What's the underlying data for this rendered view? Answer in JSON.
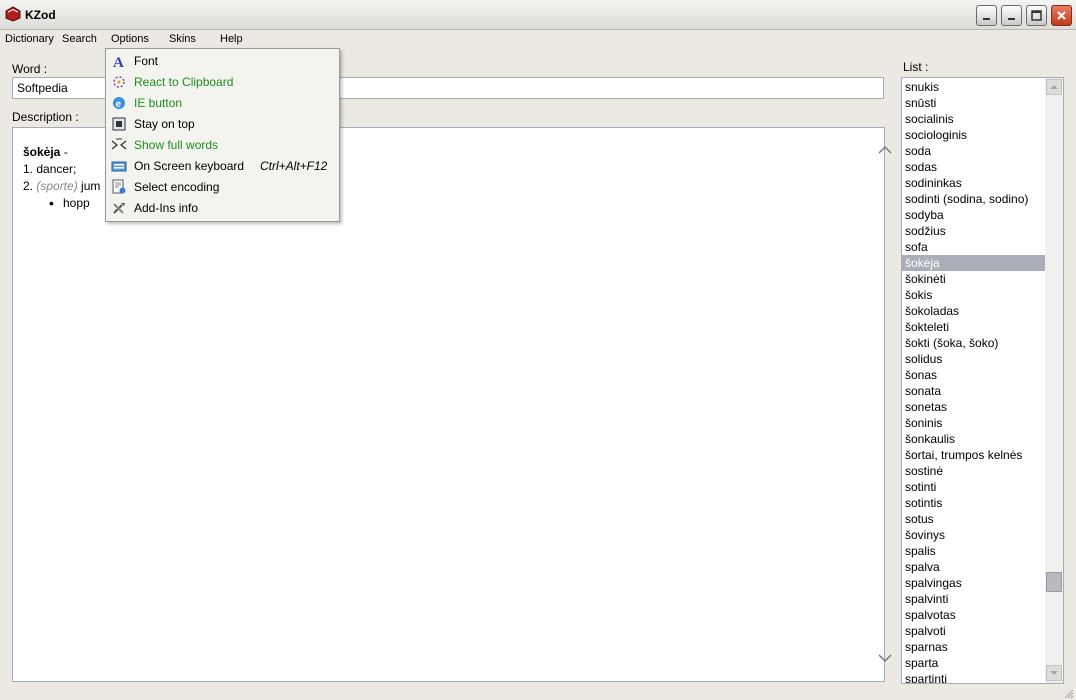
{
  "window": {
    "title": "KZod"
  },
  "menubar": [
    "Dictionary",
    "Search",
    "Options",
    "Skins",
    "Help"
  ],
  "word": {
    "label": "Word :",
    "value": "Softpedia"
  },
  "description": {
    "label": "Description :",
    "headword": "šokėja",
    "dash": " -",
    "line1": "1. dancer;",
    "line2_num": "2. ",
    "line2_tag": "(sporte)",
    "line2_text": " jum",
    "bullet": "hopp"
  },
  "list": {
    "label": "List :",
    "selected_index": 11,
    "items": [
      "snukis",
      "snūsti",
      "socialinis",
      "sociologinis",
      "soda",
      "sodas",
      "sodininkas",
      "sodinti (sodina, sodino)",
      "sodyba",
      "sodžius",
      "sofa",
      "šokėja",
      "šokinėti",
      "šokis",
      "šokoladas",
      "šokteleti",
      "šokti (šoka, šoko)",
      "solidus",
      "šonas",
      "sonata",
      "sonetas",
      "šoninis",
      "šonkaulis",
      "šortai, trumpos kelnės",
      "sostinė",
      "sotinti",
      "sotintis",
      "sotus",
      "šovinys",
      "spalis",
      "spalva",
      "spalvingas",
      "spalvinti",
      "spalvotas",
      "spalvoti",
      "sparnas",
      "sparta",
      "spartinti"
    ]
  },
  "options_menu": [
    {
      "label": "Font",
      "icon": "font-icon",
      "green": false,
      "shortcut": ""
    },
    {
      "label": "React to Clipboard",
      "icon": "clipboard-icon",
      "green": true,
      "shortcut": ""
    },
    {
      "label": "IE button",
      "icon": "ie-icon",
      "green": true,
      "shortcut": ""
    },
    {
      "label": "Stay on top",
      "icon": "stay-on-top-icon",
      "green": false,
      "shortcut": ""
    },
    {
      "label": "Show full words",
      "icon": "full-words-icon",
      "green": true,
      "shortcut": ""
    },
    {
      "label": "On Screen keyboard",
      "icon": "keyboard-icon",
      "green": false,
      "shortcut": "Ctrl+Alt+F12"
    },
    {
      "label": "Select encoding",
      "icon": "encoding-icon",
      "green": false,
      "shortcut": ""
    },
    {
      "label": "Add-Ins info",
      "icon": "tools-icon",
      "green": false,
      "shortcut": ""
    }
  ],
  "colors": {
    "selected": "#a9aeb8",
    "green_text": "#1f8c1f",
    "close_button": "#c23a1c"
  }
}
